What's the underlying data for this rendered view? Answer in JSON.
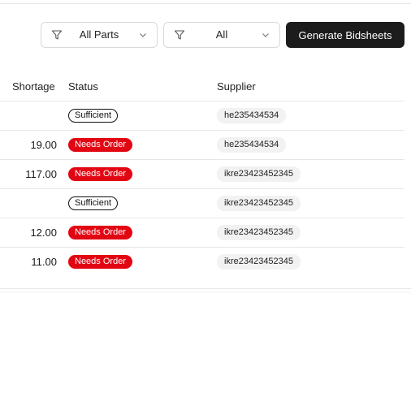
{
  "filters": {
    "parts_label": "All Parts",
    "status_label": "All",
    "generate_label": "Generate Bidsheets"
  },
  "table": {
    "headers": {
      "shortage": "Shortage",
      "status": "Status",
      "supplier": "Supplier"
    },
    "rows": [
      {
        "shortage": "",
        "status": "Sufficient",
        "supplier": "he235434534"
      },
      {
        "shortage": "19.00",
        "status": "Needs Order",
        "supplier": "he235434534"
      },
      {
        "shortage": "117.00",
        "status": "Needs Order",
        "supplier": "ikre23423452345"
      },
      {
        "shortage": "",
        "status": "Sufficient",
        "supplier": "ikre23423452345"
      },
      {
        "shortage": "12.00",
        "status": "Needs Order",
        "supplier": "ikre23423452345"
      },
      {
        "shortage": "11.00",
        "status": "Needs Order",
        "supplier": "ikre23423452345"
      }
    ]
  },
  "colors": {
    "needs_order": "#e20613",
    "button_bg": "#1c1c1c"
  },
  "icons": {
    "filter": "filter-funnel-icon",
    "dropdown": "chevron-down-icon"
  }
}
